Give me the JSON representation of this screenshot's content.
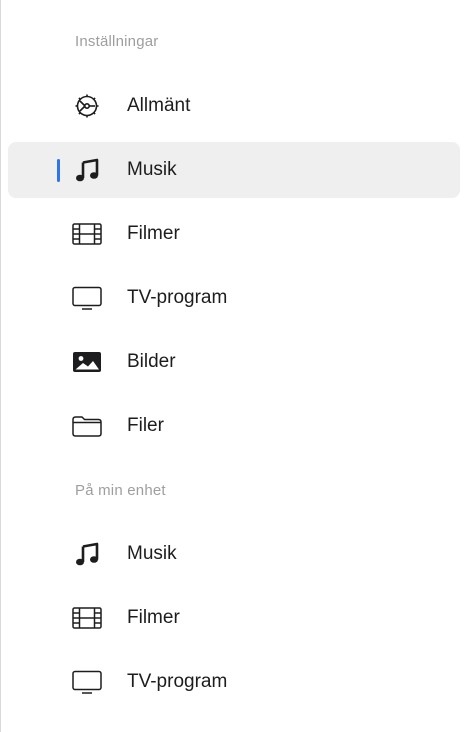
{
  "colors": {
    "accent": "#2f74e8",
    "selected_background": "#efefef",
    "section_header": "#9e9e9e",
    "label": "#1d1d1f"
  },
  "sections": [
    {
      "title": "Inställningar",
      "items": [
        {
          "label": "Allmänt",
          "icon": "gear-icon",
          "selected": false
        },
        {
          "label": "Musik",
          "icon": "music-note-icon",
          "selected": true
        },
        {
          "label": "Filmer",
          "icon": "film-icon",
          "selected": false
        },
        {
          "label": "TV-program",
          "icon": "tv-icon",
          "selected": false
        },
        {
          "label": "Bilder",
          "icon": "photo-icon",
          "selected": false
        },
        {
          "label": "Filer",
          "icon": "folder-icon",
          "selected": false
        }
      ]
    },
    {
      "title": "På min enhet",
      "items": [
        {
          "label": "Musik",
          "icon": "music-note-icon",
          "selected": false
        },
        {
          "label": "Filmer",
          "icon": "film-icon",
          "selected": false
        },
        {
          "label": "TV-program",
          "icon": "tv-icon",
          "selected": false
        }
      ]
    }
  ]
}
